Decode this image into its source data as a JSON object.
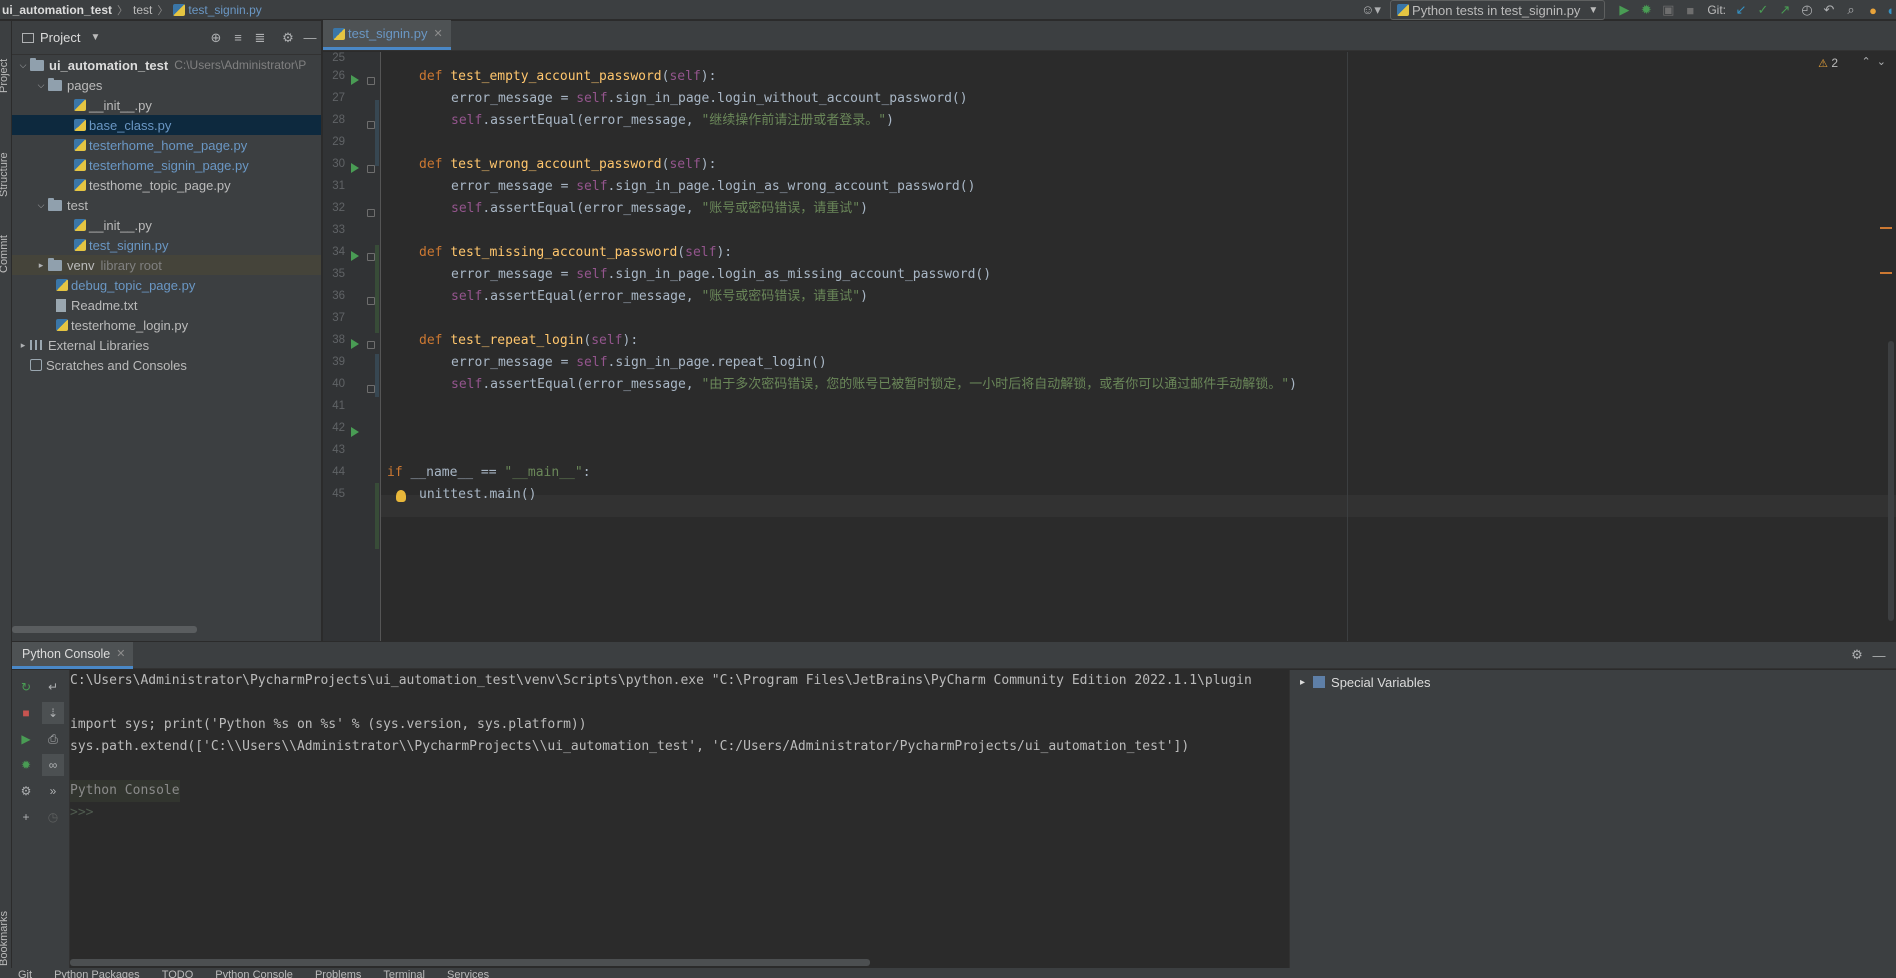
{
  "breadcrumb": {
    "project": "ui_automation_test",
    "folder": "test",
    "file": "test_signin.py"
  },
  "toolbar": {
    "run_config": "Python tests in test_signin.py",
    "git_label": "Git:"
  },
  "left_strip": {
    "project": "Project",
    "structure": "Structure",
    "commit": "Commit",
    "bookmarks": "Bookmarks"
  },
  "project_panel": {
    "title": "Project",
    "tree": [
      {
        "label": "ui_automation_test",
        "hint": "C:\\Users\\Administrator\\P",
        "kind": "root"
      },
      {
        "label": "pages",
        "kind": "folder"
      },
      {
        "label": "__init__.py",
        "kind": "file"
      },
      {
        "label": "base_class.py",
        "kind": "file"
      },
      {
        "label": "testerhome_home_page.py",
        "kind": "file"
      },
      {
        "label": "testerhome_signin_page.py",
        "kind": "file"
      },
      {
        "label": "testhome_topic_page.py",
        "kind": "file"
      },
      {
        "label": "test",
        "kind": "folder"
      },
      {
        "label": "__init__.py",
        "kind": "file"
      },
      {
        "label": "test_signin.py",
        "kind": "file"
      },
      {
        "label": "venv",
        "hint": "library root",
        "kind": "folder"
      },
      {
        "label": "debug_topic_page.py",
        "kind": "file"
      },
      {
        "label": "Readme.txt",
        "kind": "file"
      },
      {
        "label": "testerhome_login.py",
        "kind": "file"
      },
      {
        "label": "External Libraries",
        "kind": "lib"
      },
      {
        "label": "Scratches and Consoles",
        "kind": "scratch"
      }
    ]
  },
  "editor": {
    "tab": "test_signin.py",
    "warnings": "2",
    "line_numbers": [
      "25",
      "26",
      "27",
      "28",
      "29",
      "30",
      "31",
      "32",
      "33",
      "34",
      "35",
      "36",
      "37",
      "38",
      "39",
      "40",
      "41",
      "42",
      "43",
      "44",
      "45"
    ],
    "lines": {
      "l26": {
        "def": "def ",
        "name": "test_empty_account_password",
        "open": "(",
        "self": "self",
        "close": "):"
      },
      "l27": {
        "a": "error_message = ",
        "self": "self",
        "b": ".sign_in_page.login_without_account_password()"
      },
      "l28": {
        "self": "self",
        "a": ".assertEqual(error_message, ",
        "s": "\"继续操作前请注册或者登录。\"",
        "b": ")"
      },
      "l30": {
        "def": "def ",
        "name": "test_wrong_account_password",
        "open": "(",
        "self": "self",
        "close": "):"
      },
      "l31": {
        "a": "error_message = ",
        "self": "self",
        "b": ".sign_in_page.login_as_wrong_account_password()"
      },
      "l32": {
        "self": "self",
        "a": ".assertEqual(error_message, ",
        "s": "\"账号或密码错误，请重试\"",
        "b": ")"
      },
      "l34": {
        "def": "def ",
        "name": "test_missing_account_password",
        "open": "(",
        "self": "self",
        "close": "):"
      },
      "l35": {
        "a": "error_message = ",
        "self": "self",
        "b": ".sign_in_page.login_as_missing_account_password()"
      },
      "l36": {
        "self": "self",
        "a": ".assertEqual(error_message, ",
        "s": "\"账号或密码错误，请重试\"",
        "b": ")"
      },
      "l38": {
        "def": "def ",
        "name": "test_repeat_login",
        "open": "(",
        "self": "self",
        "close": "):"
      },
      "l39": {
        "a": "error_message = ",
        "self": "self",
        "b": ".sign_in_page.repeat_login()"
      },
      "l40": {
        "self": "self",
        "a": ".assertEqual(error_message, ",
        "s": "\"由于多次密码错误，您的账号已被暂时锁定，一小时后将自动解锁，或者你可以通过邮件手动解锁。\"",
        "b": ")"
      },
      "l43": {
        "if": "if ",
        "a": "__name__ == ",
        "s": "\"__main__\"",
        "b": ":"
      },
      "l44": {
        "a": "unittest.main()"
      }
    }
  },
  "console": {
    "tab": "Python Console",
    "lines": [
      "C:\\Users\\Administrator\\PycharmProjects\\ui_automation_test\\venv\\Scripts\\python.exe \"C:\\Program Files\\JetBrains\\PyCharm Community Edition 2022.1.1\\plugin",
      "import sys; print('Python %s on %s' % (sys.version, sys.platform))",
      "sys.path.extend(['C:\\\\Users\\\\Administrator\\\\PycharmProjects\\\\ui_automation_test', 'C:/Users/Administrator/PycharmProjects/ui_automation_test'])"
    ],
    "banner": "Python Console",
    "prompt": ">>>",
    "variables_title": "Special Variables"
  },
  "bottom_tabs": [
    "Git",
    "Python Packages",
    "TODO",
    "Python Console",
    "Problems",
    "Terminal",
    "Services"
  ]
}
